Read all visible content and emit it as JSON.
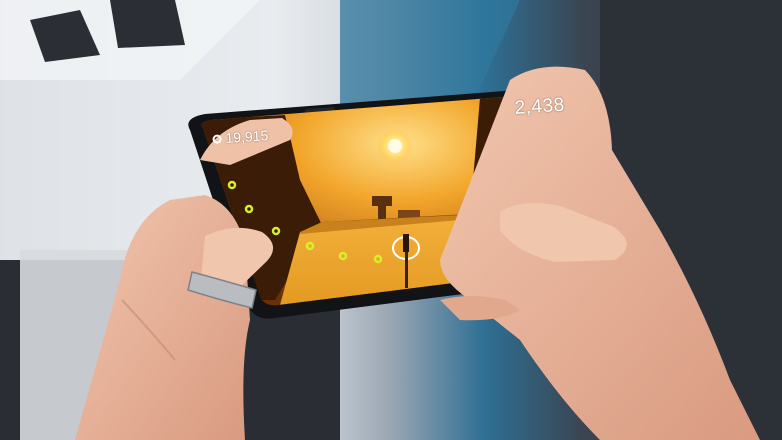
{
  "game_hud": {
    "coin_count": "19,915",
    "score": "2,438",
    "coin_icon": "coin-icon"
  },
  "colors": {
    "sky_glow": "#f7b42c",
    "sun": "#fff3c0",
    "coin": "#d6f02a",
    "phone_body": "#111316",
    "skin": "#e8b49a"
  }
}
